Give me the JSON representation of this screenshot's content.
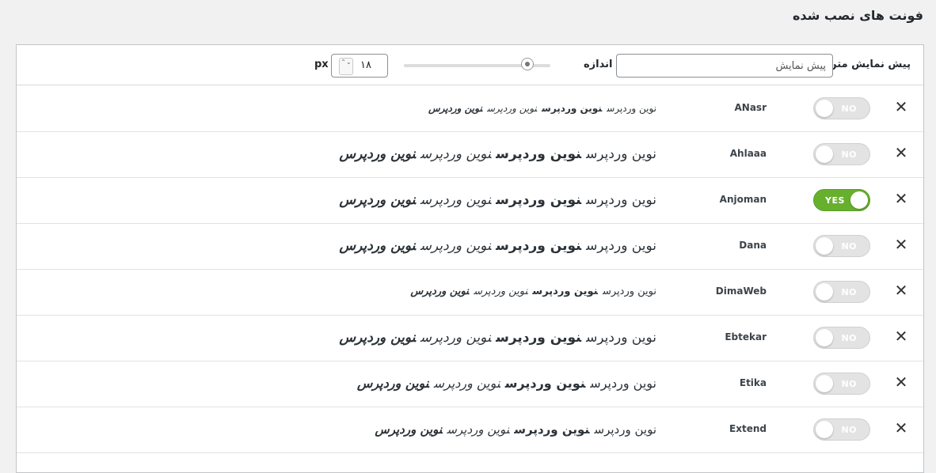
{
  "title": "فونت های نصب شده",
  "toolbar": {
    "preview_label": "پیش نمایش متن",
    "preview_value": "پیش نمایش",
    "size_label": "اندازه",
    "size_value": "۱۸",
    "unit": "px",
    "stepper_icons": "⌃⌄"
  },
  "toggle_labels": {
    "on": "YES",
    "off": "NO"
  },
  "accent_colors": {
    "toggle_on": "#67b02e",
    "toggle_off": "#e3e3e3"
  },
  "sample_text": "نوین وردپرس",
  "fonts": [
    {
      "name": "ANasr",
      "enabled": false,
      "toggle_label": "NO",
      "sample": "نوین وردپرس",
      "remove": "✕"
    },
    {
      "name": "Ahlaaa",
      "enabled": false,
      "toggle_label": "NO",
      "sample": "نوین وردپرس",
      "remove": "✕"
    },
    {
      "name": "Anjoman",
      "enabled": true,
      "toggle_label": "YES",
      "sample": "نوین وردپرس",
      "remove": "✕"
    },
    {
      "name": "Dana",
      "enabled": false,
      "toggle_label": "NO",
      "sample": "نوین وردپرس",
      "remove": "✕"
    },
    {
      "name": "DimaWeb",
      "enabled": false,
      "toggle_label": "NO",
      "sample": "نوین وردپرس",
      "remove": "✕"
    },
    {
      "name": "Ebtekar",
      "enabled": false,
      "toggle_label": "NO",
      "sample": "نوین وردپرس",
      "remove": "✕"
    },
    {
      "name": "Etika",
      "enabled": false,
      "toggle_label": "NO",
      "sample": "نوین وردپرس",
      "remove": "✕"
    },
    {
      "name": "Extend",
      "enabled": false,
      "toggle_label": "NO",
      "sample": "نوین وردپرس",
      "remove": "✕"
    }
  ]
}
